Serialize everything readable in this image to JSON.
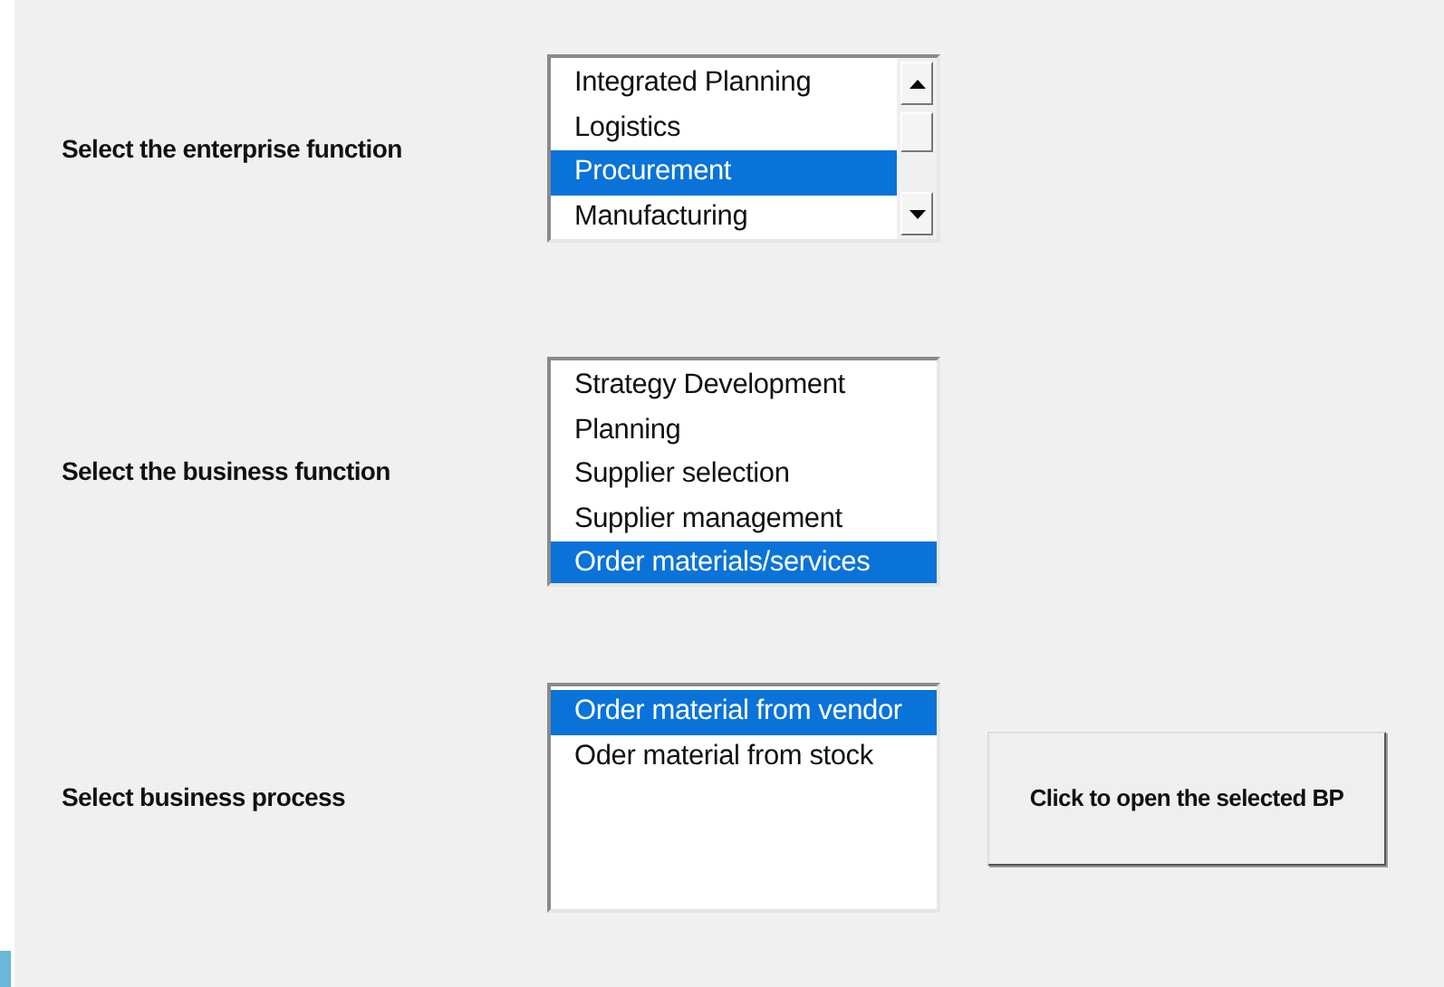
{
  "selectors": [
    {
      "label": "Select the enterprise function",
      "scrollbar": true,
      "items": [
        {
          "text": "Integrated Planning",
          "selected": false
        },
        {
          "text": "Logistics",
          "selected": false
        },
        {
          "text": "Procurement",
          "selected": true
        },
        {
          "text": "Manufacturing",
          "selected": false
        }
      ]
    },
    {
      "label": "Select the business function",
      "scrollbar": false,
      "items": [
        {
          "text": "Strategy Development",
          "selected": false
        },
        {
          "text": "Planning",
          "selected": false
        },
        {
          "text": "Supplier selection",
          "selected": false
        },
        {
          "text": "Supplier management",
          "selected": false
        },
        {
          "text": "Order materials/services",
          "selected": true
        }
      ]
    },
    {
      "label": "Select business process",
      "scrollbar": false,
      "items": [
        {
          "text": "Order material from vendor",
          "selected": true
        },
        {
          "text": "Oder material from stock",
          "selected": false
        }
      ]
    }
  ],
  "open_button": {
    "label": "Click to open the selected BP"
  }
}
